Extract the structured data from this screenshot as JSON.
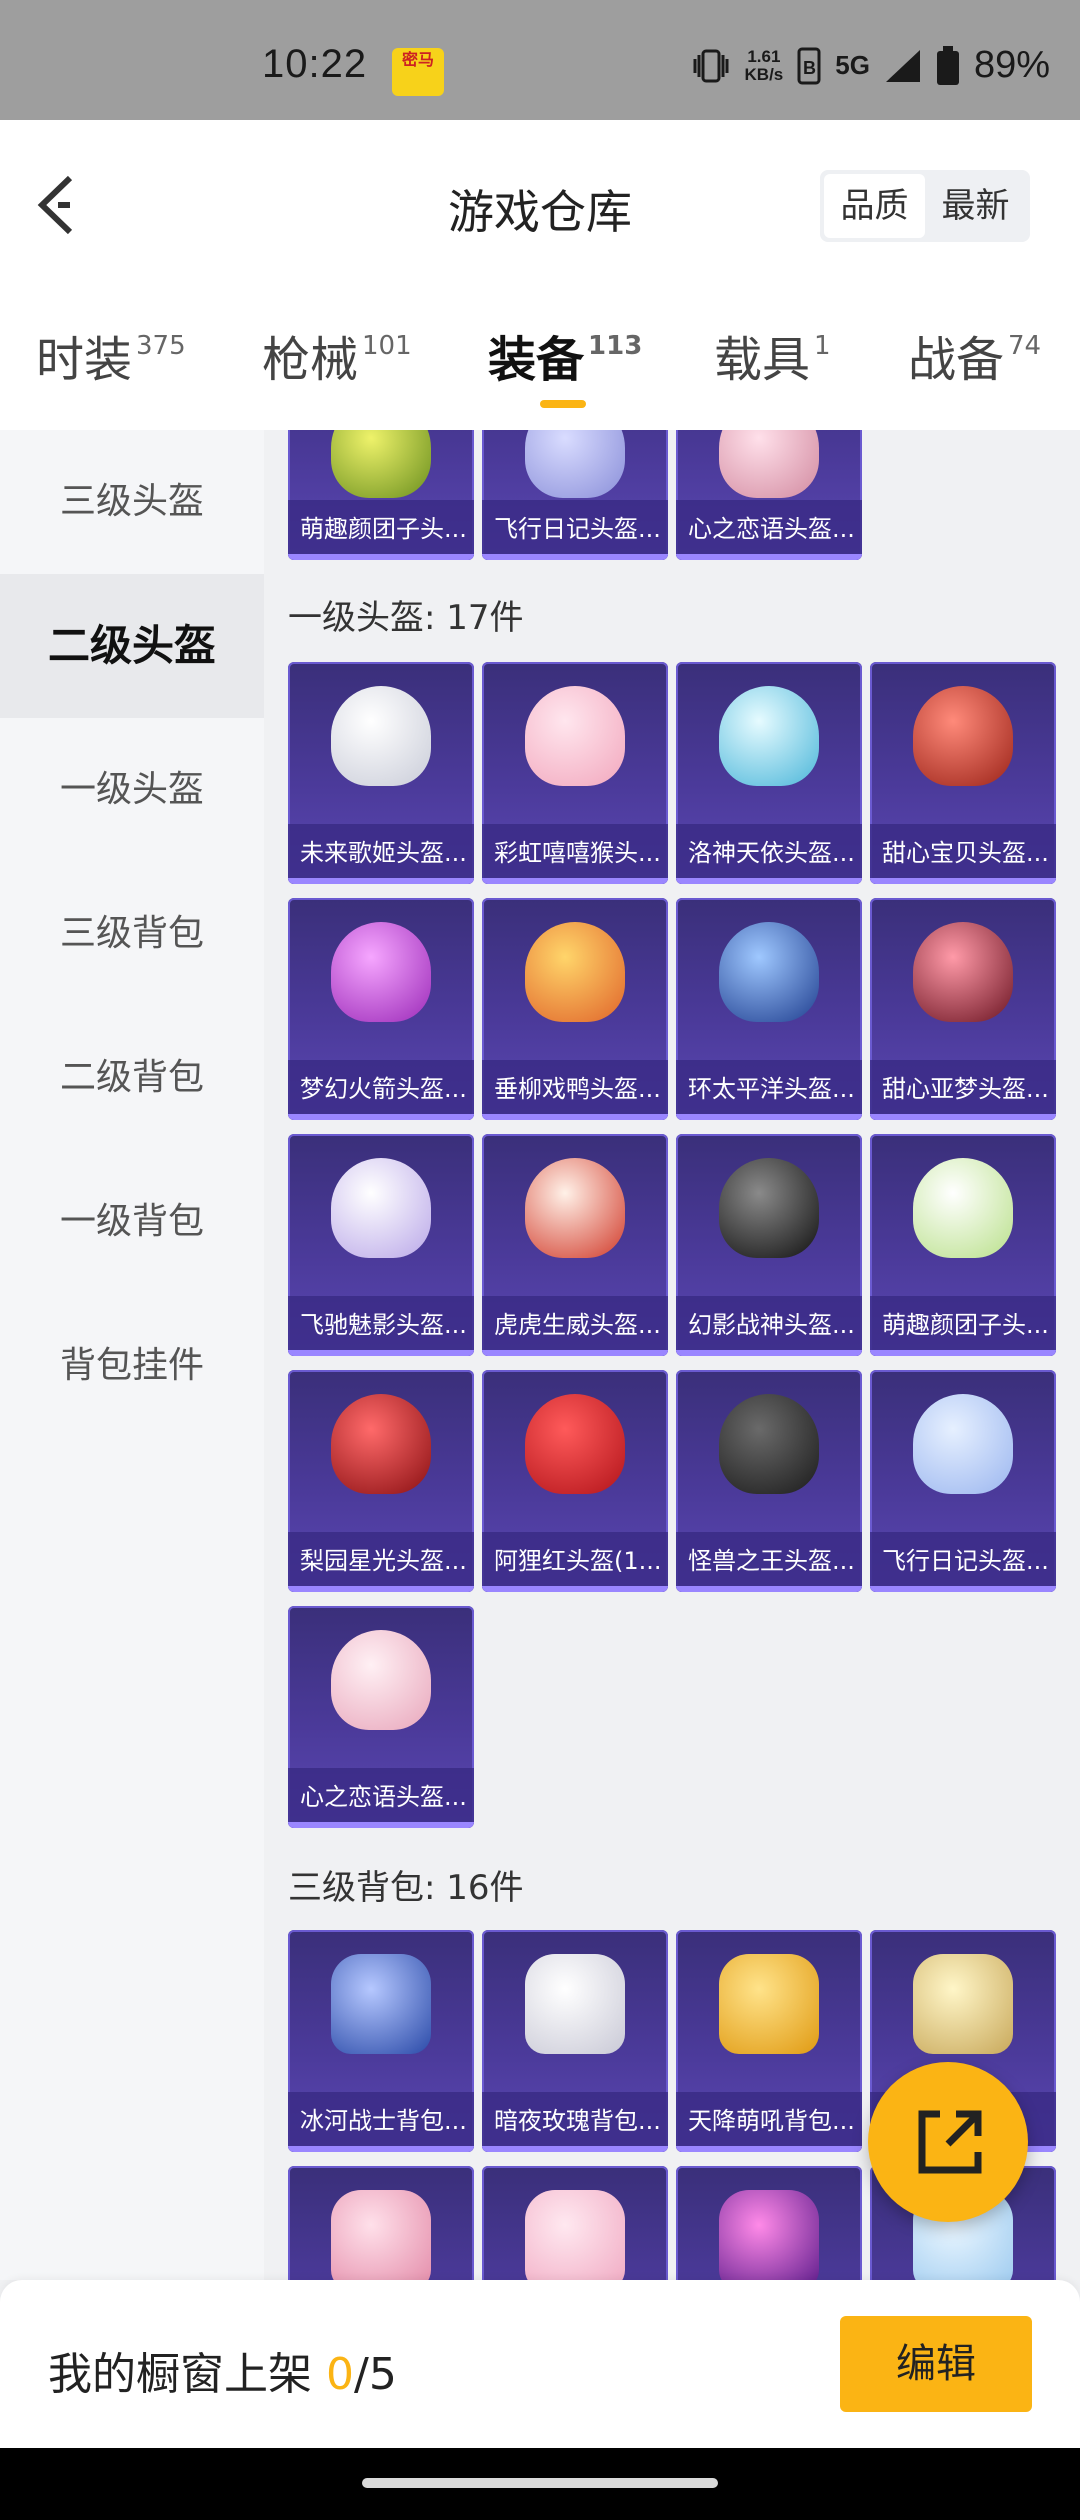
{
  "status_bar": {
    "time": "10:22",
    "app_badge": "密马",
    "net_speed_value": "1.61",
    "net_speed_unit": "KB/s",
    "network": "5G",
    "battery": "89%"
  },
  "header": {
    "title": "游戏仓库",
    "sort_options": [
      "品质",
      "最新"
    ],
    "active_sort": "品质"
  },
  "tabs": [
    {
      "label": "时装",
      "count": "375"
    },
    {
      "label": "枪械",
      "count": "101"
    },
    {
      "label": "装备",
      "count": "113",
      "active": true
    },
    {
      "label": "载具",
      "count": "1"
    },
    {
      "label": "战备",
      "count": "74"
    }
  ],
  "sidebar": {
    "items": [
      "三级头盔",
      "二级头盔",
      "一级头盔",
      "三级背包",
      "二级背包",
      "一级背包",
      "背包挂件"
    ],
    "active": "二级头盔"
  },
  "sections": {
    "prev_row": [
      "萌趣颜团子头...",
      "飞行日记头盔...",
      "心之恋语头盔..."
    ],
    "helmet1": {
      "title": "一级头盔: 17件",
      "items": [
        "未来歌姬头盔...",
        "彩虹嘻嘻猴头...",
        "洛神天依头盔...",
        "甜心宝贝头盔...",
        "梦幻火箭头盔...",
        "垂柳戏鸭头盔...",
        "环太平洋头盔...",
        "甜心亚梦头盔...",
        "飞驰魅影头盔...",
        "虎虎生威头盔...",
        "幻影战神头盔...",
        "萌趣颜团子头...",
        "梨园星光头盔...",
        "阿狸红头盔(1...",
        "怪兽之王头盔...",
        "飞行日记头盔...",
        "心之恋语头盔..."
      ]
    },
    "backpack3": {
      "title": "三级背包: 16件",
      "items": [
        "冰河战士背包...",
        "暗夜玫瑰背包...",
        "天降萌吼背包...",
        "..."
      ]
    }
  },
  "bottom_bar": {
    "showcase_label": "我的橱窗上架",
    "showcase_current": "0",
    "showcase_total": "/5",
    "edit_label": "编辑"
  },
  "colors": {
    "accent": "#fbb414",
    "card_bg": "#4b3a9a"
  }
}
